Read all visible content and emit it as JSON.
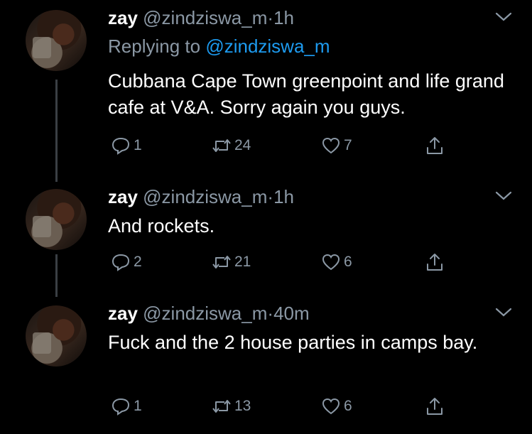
{
  "tweets": [
    {
      "name": "zay",
      "handle": "@zindziswa_m",
      "separator": "·",
      "time": "1h",
      "replying_prefix": "Replying to",
      "replying_to": "@zindziswa_m",
      "text": "Cubbana Cape Town greenpoint and life grand cafe at V&A. Sorry again you guys.",
      "replies": "1",
      "retweets": "24",
      "likes": "7"
    },
    {
      "name": "zay",
      "handle": "@zindziswa_m",
      "separator": "·",
      "time": "1h",
      "text": "And rockets.",
      "replies": "2",
      "retweets": "21",
      "likes": "6"
    },
    {
      "name": "zay",
      "handle": "@zindziswa_m",
      "separator": "·",
      "time": "40m",
      "text": "Fuck and the 2 house parties in camps bay.",
      "replies": "1",
      "retweets": "13",
      "likes": "6"
    }
  ],
  "icons": {
    "reply": "reply-icon",
    "retweet": "retweet-icon",
    "like": "heart-icon",
    "share": "share-icon",
    "menu": "chevron-down-icon"
  },
  "colors": {
    "background": "#000000",
    "secondary_text": "#8b98a5",
    "mention": "#1d9bf0",
    "thread_line": "#3a3f44"
  }
}
